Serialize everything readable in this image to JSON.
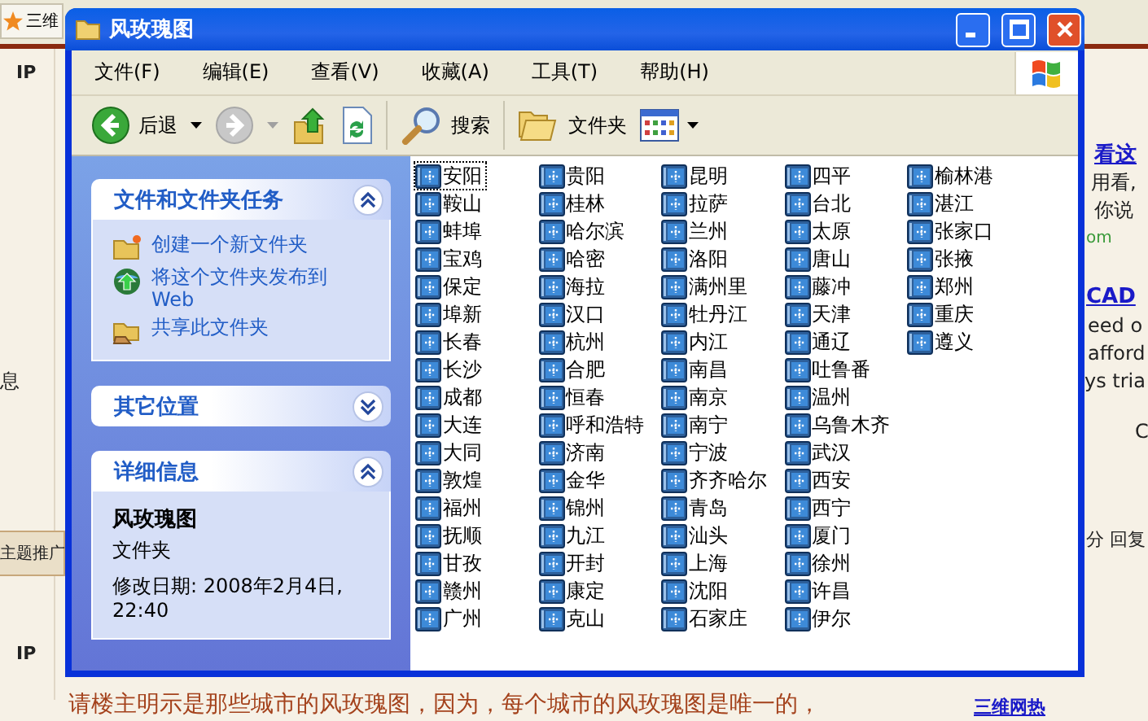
{
  "background": {
    "tab": "三维",
    "texts": [
      {
        "kind": "label",
        "text": "IP"
      },
      {
        "kind": "plain",
        "text": "息"
      },
      {
        "kind": "tab",
        "text": "主题推广"
      },
      {
        "kind": "label",
        "text": "IP"
      },
      {
        "kind": "reply",
        "text": "请楼主明示是那些城市的风玫瑰图，因为，每个城市的风玫瑰图是唯一的，"
      },
      {
        "kind": "link",
        "text": "看这"
      },
      {
        "kind": "plain",
        "text": "用看,"
      },
      {
        "kind": "plain",
        "text": "你说"
      },
      {
        "kind": "url",
        "text": "om"
      },
      {
        "kind": "link",
        "text": "CAD"
      },
      {
        "kind": "plain",
        "text": "eed o"
      },
      {
        "kind": "plain",
        "text": "afford"
      },
      {
        "kind": "plain",
        "text": "ys tria"
      },
      {
        "kind": "plain",
        "text": "C"
      },
      {
        "kind": "plain",
        "text": "分 回复"
      },
      {
        "kind": "link",
        "text": "三维网热"
      }
    ]
  },
  "window": {
    "title": "风玫瑰图"
  },
  "menu": [
    "文件(F)",
    "编辑(E)",
    "查看(V)",
    "收藏(A)",
    "工具(T)",
    "帮助(H)"
  ],
  "toolbar": [
    {
      "kind": "back",
      "label": "后退",
      "disabled": false
    },
    {
      "kind": "forward",
      "disabled": true
    },
    {
      "kind": "up"
    },
    {
      "kind": "sync"
    },
    {
      "kind": "search",
      "label": "搜索"
    },
    {
      "kind": "folders",
      "label": "文件夹"
    },
    {
      "kind": "views"
    }
  ],
  "task_pane": [
    {
      "title": "文件和文件夹任务",
      "expanded": true,
      "items": [
        {
          "kind": "new-folder",
          "label": "创建一个新文件夹"
        },
        {
          "kind": "publish",
          "label": "将这个文件夹发布到 Web"
        },
        {
          "kind": "share",
          "label": "共享此文件夹"
        }
      ]
    },
    {
      "title": "其它位置",
      "expanded": false
    },
    {
      "title": "详细信息",
      "expanded": true,
      "details": {
        "name": "风玫瑰图",
        "type": "文件夹",
        "modified": "修改日期: 2008年2月4日, 22:40"
      }
    }
  ],
  "files": [
    {
      "name": "安阳",
      "selected": true
    },
    {
      "name": "鞍山",
      "selected": false
    },
    {
      "name": "蚌埠",
      "selected": false
    },
    {
      "name": "宝鸡",
      "selected": false
    },
    {
      "name": "保定",
      "selected": false
    },
    {
      "name": "埠新",
      "selected": false
    },
    {
      "name": "长春",
      "selected": false
    },
    {
      "name": "长沙",
      "selected": false
    },
    {
      "name": "成都",
      "selected": false
    },
    {
      "name": "大连",
      "selected": false
    },
    {
      "name": "大同",
      "selected": false
    },
    {
      "name": "敦煌",
      "selected": false
    },
    {
      "name": "福州",
      "selected": false
    },
    {
      "name": "抚顺",
      "selected": false
    },
    {
      "name": "甘孜",
      "selected": false
    },
    {
      "name": "赣州",
      "selected": false
    },
    {
      "name": "广州",
      "selected": false
    },
    {
      "name": "贵阳",
      "selected": false
    },
    {
      "name": "桂林",
      "selected": false
    },
    {
      "name": "哈尔滨",
      "selected": false
    },
    {
      "name": "哈密",
      "selected": false
    },
    {
      "name": "海拉",
      "selected": false
    },
    {
      "name": "汉口",
      "selected": false
    },
    {
      "name": "杭州",
      "selected": false
    },
    {
      "name": "合肥",
      "selected": false
    },
    {
      "name": "恒春",
      "selected": false
    },
    {
      "name": "呼和浩特",
      "selected": false
    },
    {
      "name": "济南",
      "selected": false
    },
    {
      "name": "金华",
      "selected": false
    },
    {
      "name": "锦州",
      "selected": false
    },
    {
      "name": "九江",
      "selected": false
    },
    {
      "name": "开封",
      "selected": false
    },
    {
      "name": "康定",
      "selected": false
    },
    {
      "name": "克山",
      "selected": false
    },
    {
      "name": "昆明",
      "selected": false
    },
    {
      "name": "拉萨",
      "selected": false
    },
    {
      "name": "兰州",
      "selected": false
    },
    {
      "name": "洛阳",
      "selected": false
    },
    {
      "name": "满州里",
      "selected": false
    },
    {
      "name": "牡丹江",
      "selected": false
    },
    {
      "name": "内江",
      "selected": false
    },
    {
      "name": "南昌",
      "selected": false
    },
    {
      "name": "南京",
      "selected": false
    },
    {
      "name": "南宁",
      "selected": false
    },
    {
      "name": "宁波",
      "selected": false
    },
    {
      "name": "齐齐哈尔",
      "selected": false
    },
    {
      "name": "青岛",
      "selected": false
    },
    {
      "name": "汕头",
      "selected": false
    },
    {
      "name": "上海",
      "selected": false
    },
    {
      "name": "沈阳",
      "selected": false
    },
    {
      "name": "石家庄",
      "selected": false
    },
    {
      "name": "四平",
      "selected": false
    },
    {
      "name": "台北",
      "selected": false
    },
    {
      "name": "太原",
      "selected": false
    },
    {
      "name": "唐山",
      "selected": false
    },
    {
      "name": "藤冲",
      "selected": false
    },
    {
      "name": "天津",
      "selected": false
    },
    {
      "name": "通辽",
      "selected": false
    },
    {
      "name": "吐鲁番",
      "selected": false
    },
    {
      "name": "温州",
      "selected": false
    },
    {
      "name": "乌鲁木齐",
      "selected": false
    },
    {
      "name": "武汉",
      "selected": false
    },
    {
      "name": "西安",
      "selected": false
    },
    {
      "name": "西宁",
      "selected": false
    },
    {
      "name": "厦门",
      "selected": false
    },
    {
      "name": "徐州",
      "selected": false
    },
    {
      "name": "许昌",
      "selected": false
    },
    {
      "name": "伊尔",
      "selected": false
    },
    {
      "name": "榆林港",
      "selected": false
    },
    {
      "name": "湛江",
      "selected": false
    },
    {
      "name": "张家口",
      "selected": false
    },
    {
      "name": "张掖",
      "selected": false
    },
    {
      "name": "郑州",
      "selected": false
    },
    {
      "name": "重庆",
      "selected": false
    },
    {
      "name": "遵义",
      "selected": false
    }
  ]
}
